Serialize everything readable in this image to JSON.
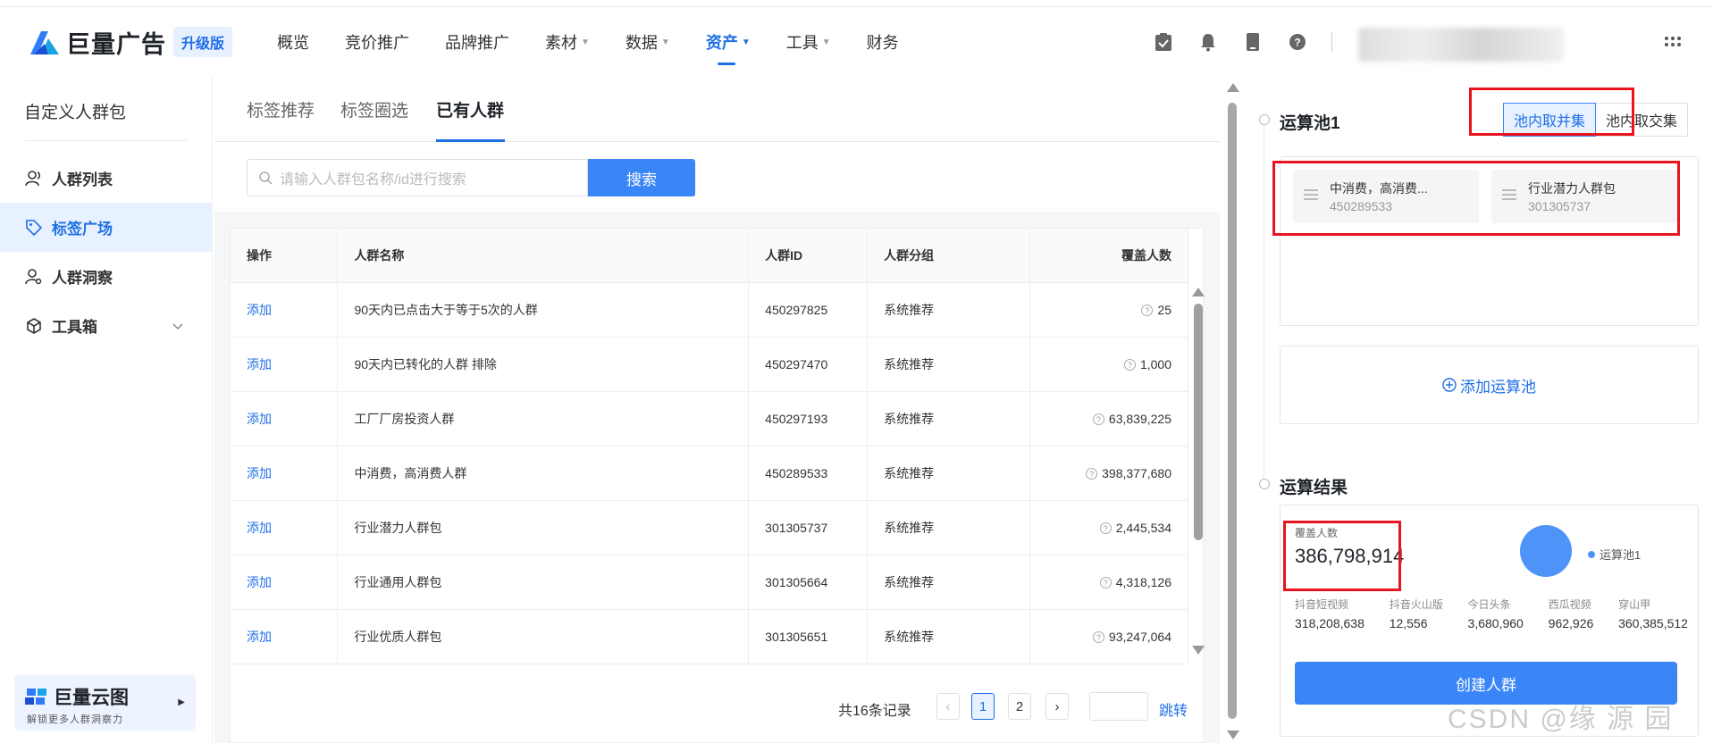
{
  "header": {
    "brand": "巨量广告",
    "upgrade_badge": "升级版",
    "nav": [
      {
        "label": "概览",
        "caret": false
      },
      {
        "label": "竞价推广",
        "caret": false
      },
      {
        "label": "品牌推广",
        "caret": false
      },
      {
        "label": "素材",
        "caret": true
      },
      {
        "label": "数据",
        "caret": true
      },
      {
        "label": "资产",
        "caret": true,
        "active": true
      },
      {
        "label": "工具",
        "caret": true
      },
      {
        "label": "财务",
        "caret": false
      }
    ]
  },
  "sidebar": {
    "title": "自定义人群包",
    "items": [
      {
        "label": "人群列表"
      },
      {
        "label": "标签广场",
        "active": true
      },
      {
        "label": "人群洞察"
      },
      {
        "label": "工具箱"
      }
    ],
    "promo": {
      "title": "巨量云图",
      "subtitle": "解锁更多人群洞察力"
    }
  },
  "main": {
    "tabs": [
      "标签推荐",
      "标签圈选",
      "已有人群"
    ],
    "active_tab": "已有人群",
    "search": {
      "placeholder": "请输入人群包名称/id进行搜索",
      "button": "搜索"
    },
    "table": {
      "headers": [
        "操作",
        "人群名称",
        "人群ID",
        "人群分组",
        "覆盖人数"
      ],
      "rows": [
        {
          "action": "添加",
          "name": "90天内已点击大于等于5次的人群",
          "id": "450297825",
          "group": "系统推荐",
          "coverage": "25"
        },
        {
          "action": "添加",
          "name": "90天内已转化的人群 排除",
          "id": "450297470",
          "group": "系统推荐",
          "coverage": "1,000"
        },
        {
          "action": "添加",
          "name": "工厂厂房投资人群",
          "id": "450297193",
          "group": "系统推荐",
          "coverage": "63,839,225"
        },
        {
          "action": "添加",
          "name": "中消费，高消费人群",
          "id": "450289533",
          "group": "系统推荐",
          "coverage": "398,377,680"
        },
        {
          "action": "添加",
          "name": "行业潜力人群包",
          "id": "301305737",
          "group": "系统推荐",
          "coverage": "2,445,534"
        },
        {
          "action": "添加",
          "name": "行业通用人群包",
          "id": "301305664",
          "group": "系统推荐",
          "coverage": "4,318,126"
        },
        {
          "action": "添加",
          "name": "行业优质人群包",
          "id": "301305651",
          "group": "系统推荐",
          "coverage": "93,247,064"
        }
      ]
    },
    "pagination": {
      "total": "共16条记录",
      "pages": [
        "1",
        "2"
      ],
      "current": "1",
      "prev": "‹",
      "next": "›",
      "jump": "跳转"
    }
  },
  "right": {
    "pool_title": "运算池1",
    "seg": [
      "池内取并集",
      "池内取交集"
    ],
    "chips": [
      {
        "name": "中消费，高消费...",
        "id": "450289533"
      },
      {
        "name": "行业潜力人群包",
        "id": "301305737"
      }
    ],
    "add_pool": "添加运算池",
    "result_title": "运算结果",
    "coverage_label": "覆盖人数",
    "coverage_value": "386,798,914",
    "legend": "运算池1",
    "platforms": [
      {
        "label": "抖音短视频",
        "value": "318,208,638"
      },
      {
        "label": "抖音火山版",
        "value": "12,556"
      },
      {
        "label": "今日头条",
        "value": "3,680,960"
      },
      {
        "label": "西瓜视频",
        "value": "962,926"
      },
      {
        "label": "穿山甲",
        "value": "360,385,512"
      }
    ],
    "create_button": "创建人群"
  },
  "watermark": "CSDN @缘  源  园",
  "colors": {
    "accent": "#1f6fe5",
    "button": "#3a86f7",
    "highlight": "#e8141f"
  }
}
